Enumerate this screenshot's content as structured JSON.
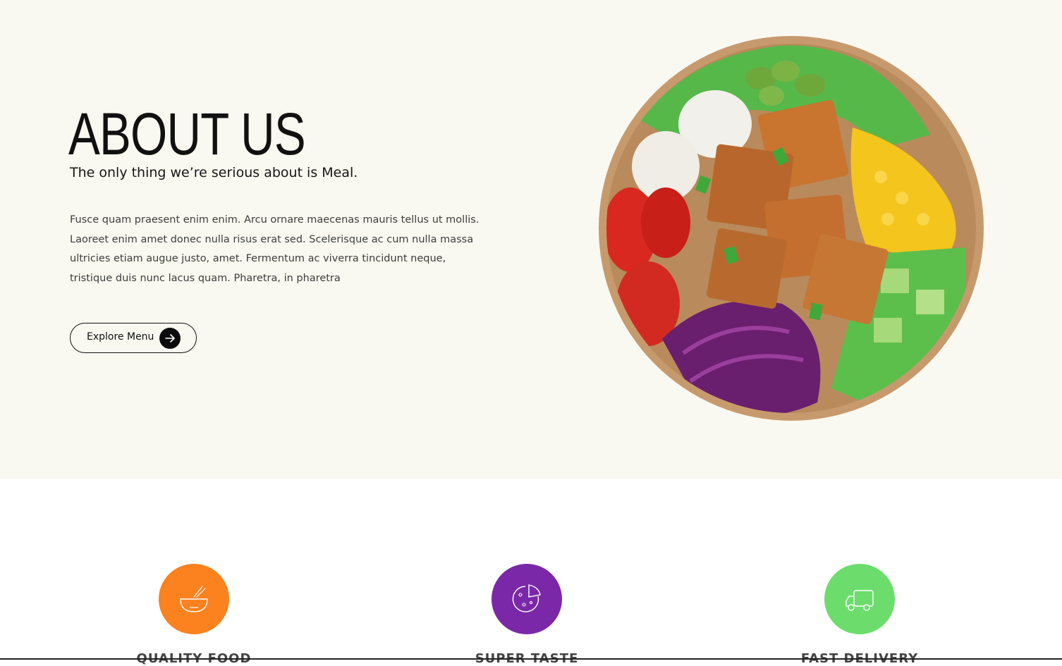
{
  "about": {
    "title": "ABOUT US",
    "subtitle": "The only thing we’re serious about is Meal.",
    "body": "Fusce quam praesent enim enim. Arcu ornare maecenas mauris tellus ut mollis. Laoreet enim amet donec nulla risus erat sed. Scelerisque ac cum nulla massa ultricies etiam augue justo, amet. Fermentum ac viverra tincidunt neque, tristique duis nunc lacus quam. Pharetra, in pharetra",
    "cta_label": "Explore Menu",
    "cta_icon": "arrow-right-icon",
    "image_icon": "salad-bowl-image",
    "background": "#f9f9f1"
  },
  "features": [
    {
      "title": "QUALITY FOOD",
      "icon": "bowl-icon",
      "color": "#fb821e"
    },
    {
      "title": "SUPER TASTE",
      "icon": "pizza-icon",
      "color": "#7a28a8"
    },
    {
      "title": "FAST DELIVERY",
      "icon": "truck-icon",
      "color": "#6cdd6c"
    }
  ]
}
